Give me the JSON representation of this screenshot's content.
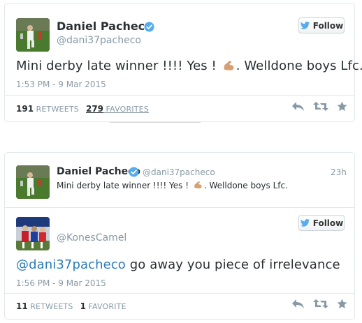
{
  "colors": {
    "accent": "#2b7bb9",
    "verified": "#55acee",
    "muted": "#8899a6",
    "text": "#292f33"
  },
  "tweet1": {
    "author_name": "Daniel Pacheco",
    "author_handle": "@dani37pacheco",
    "follow_label": "Follow",
    "text_before_emoji": "Mini derby late winner !!!! Yes ! ",
    "emoji": "flexed-biceps",
    "text_after_emoji": ". Welldone boys Lfc.",
    "timestamp": "1:53 PM - 9 Mar 2015",
    "retweets_count": "191",
    "retweets_label": "RETWEETS",
    "favorites_count": "279",
    "favorites_label": "FAVORITES"
  },
  "tweet2": {
    "quoted": {
      "author_name": "Daniel Pacheco",
      "author_handle": "@dani37pacheco",
      "time_ago": "23h",
      "text_before_emoji": "Mini derby late winner !!!! Yes ! ",
      "emoji": "flexed-biceps",
      "text_after_emoji": ". Welldone boys Lfc."
    },
    "author_handle": "@KonesCamel",
    "follow_label": "Follow",
    "mention": "@dani37pacheco",
    "text": " go away you piece of irrelevance",
    "timestamp": "1:56 PM - 9 Mar 2015",
    "retweets_count": "11",
    "retweets_label": "RETWEETS",
    "favorites_count": "1",
    "favorites_label": "FAVORITE"
  },
  "icons": [
    "verified-icon",
    "twitter-bird-icon",
    "reply-icon",
    "retweet-icon",
    "favorite-star-icon",
    "flexed-biceps-emoji"
  ]
}
